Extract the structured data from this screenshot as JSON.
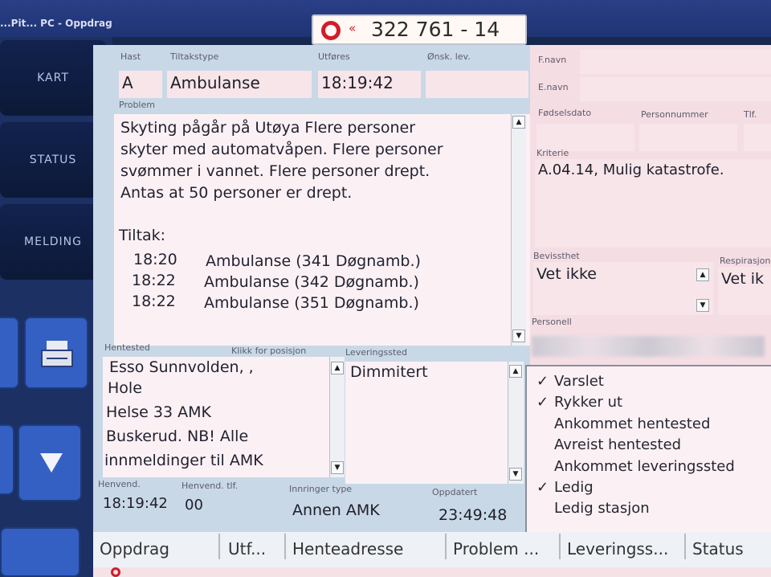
{
  "window": {
    "title": "...Pit... PC - Oppdrag"
  },
  "callout_number": "322 761 - 14",
  "nav": {
    "kart": "KART",
    "status": "STATUS",
    "melding": "MELDING"
  },
  "labels": {
    "hast": "Hast",
    "tiltakstype": "Tiltakstype",
    "utfores": "Utføres",
    "onsk_lev": "Ønsk. lev.",
    "problem": "Problem",
    "hentested": "Hentested",
    "klikk_posisjon": "Klikk for posisjon",
    "leveringssted": "Leveringssted",
    "henvend": "Henvend.",
    "henvend_tlf": "Henvend. tlf.",
    "innringer_type": "Innringer type",
    "oppdatert": "Oppdatert",
    "fnavn": "F.navn",
    "enavn": "E.navn",
    "fodselsdato": "Fødselsdato",
    "personnummer": "Personnummer",
    "tlf": "Tlf.",
    "kriterie": "Kriterie",
    "bevissthet": "Bevissthet",
    "respirasjon": "Respirasjon",
    "personell": "Personell"
  },
  "fields": {
    "hast": "A",
    "tiltakstype": "Ambulanse",
    "utfores": "18:19:42",
    "onsk_lev": "",
    "fnavn": "",
    "enavn": "",
    "fodselsdato": "",
    "personnummer": "",
    "tlf": "",
    "kriterie": "A.04.14, Mulig katastrofe.",
    "bevissthet": "Vet ikke",
    "respirasjon": "Vet ik",
    "henvend": "18:19:42",
    "henvend_tlf": "00",
    "innringer_type": "Annen AMK",
    "oppdatert": "23:49:48"
  },
  "problem_lines": [
    "Skyting pågår på Utøya Flere personer",
    "skyter med automatvåpen. Flere personer",
    "svømmer i vannet. Flere personer drept.",
    "Antas at 50 personer er drept."
  ],
  "tiltak": {
    "heading": "Tiltak:",
    "rows": [
      {
        "time": "18:20",
        "text": "Ambulanse (341 Døgnamb.)"
      },
      {
        "time": "18:22",
        "text": "Ambulanse (342 Døgnamb.)"
      },
      {
        "time": "18:22",
        "text": "Ambulanse (351 Døgnamb.)"
      }
    ]
  },
  "hentested_lines": [
    "Esso Sunnvolden, ,",
    "Hole",
    "Helse 33 AMK",
    "Buskerud. NB! Alle",
    "innmeldinger til AMK"
  ],
  "leveringssted_value": "Dimmitert",
  "status_list": [
    {
      "label": "Varslet",
      "check": "✓"
    },
    {
      "label": "Rykker ut",
      "check": "✓"
    },
    {
      "label": "Ankommet hentested",
      "check": ""
    },
    {
      "label": "Avreist hentested",
      "check": ""
    },
    {
      "label": "Ankommet leveringssted",
      "check": ""
    },
    {
      "label": "Ledig",
      "check": "✓"
    },
    {
      "label": "Ledig stasjon",
      "check": ""
    }
  ],
  "tabs": [
    "Oppdrag",
    "Utf...",
    "Henteadresse",
    "Problem ...",
    "Leveringss...",
    "Status"
  ],
  "colors": {
    "accent_red": "#d21c2a",
    "nav_dark": "#0c1937",
    "form_bg": "#c9d8e6",
    "field_pink": "#f8e5ea"
  }
}
